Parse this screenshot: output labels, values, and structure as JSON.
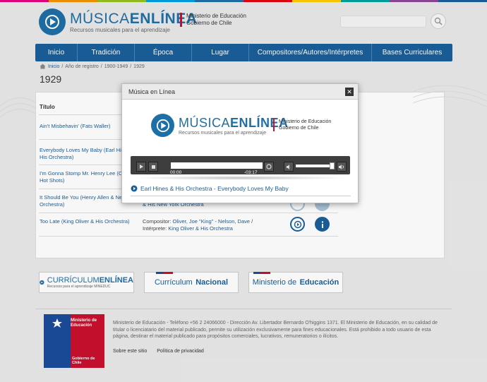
{
  "colors": {
    "brand_blue": "#1e6fa6",
    "nav_blue": "#1a5f9a",
    "gov_red": "#c8102e",
    "top_stripe": [
      "#e6007e",
      "#f39200",
      "#95c11f",
      "#009fe3",
      "#1e6fa6",
      "#e30613",
      "#ffcc00",
      "#00a19a",
      "#8e4796",
      "#1a5f9a"
    ]
  },
  "header": {
    "logo_title_light": "MÚSICA",
    "logo_title_bold": "ENLÍNEA",
    "logo_subtitle": "Recursos musicales para el aprendizaje",
    "gov_line1": "Ministerio de Educación",
    "gov_line2": "Gobierno de Chile",
    "search_placeholder": "",
    "search_icon": "search-icon"
  },
  "nav": {
    "items": [
      {
        "label": "Inicio"
      },
      {
        "label": "Tradición"
      },
      {
        "label": "Época"
      },
      {
        "label": "Lugar"
      },
      {
        "label": "Compositores/Autores/Intérpretes"
      },
      {
        "label": "Bases Curriculares"
      }
    ]
  },
  "breadcrumb": {
    "home": "Inicio",
    "sep1": "/",
    "level2": "Año de registro",
    "sep2": "/",
    "level3": "1900-1949",
    "sep3": "/",
    "level4": "1929"
  },
  "page": {
    "title": "1929",
    "column_title": "Título"
  },
  "rows": [
    {
      "title": "Ain't Misbehavin' (Fats Waller)"
    },
    {
      "title": "Everybody Loves My Baby (Earl Hines & His Orchestra)"
    },
    {
      "title": "I'm Gonna Stomp Mr. Henry Lee (Condon Hot Shots)"
    },
    {
      "title": "It Should Be You (Henry Allen & New York Orchestra)",
      "detail_tail": "& His New York Orchestra"
    },
    {
      "title": "Too Late (King Oliver & His Orchestra)",
      "composer_label": "Compositor:",
      "composer_value": "Oliver, Joe \"King\"  - Nelson, Dave",
      "separator": "/",
      "performer_label": "Intérprete:",
      "performer_value": "King Oliver & His Orchestra"
    }
  ],
  "partners": {
    "curriculum_light": "CURRÍCULUM",
    "curriculum_bold": "ENLÍNEA",
    "curriculum_sub": "Recursos para el aprendizaje MINEDUC",
    "nacional_light": "Currículum",
    "nacional_bold": "Nacional",
    "mineduc_light": "Ministerio de",
    "mineduc_bold": "Educación"
  },
  "footer": {
    "logo_line1": "Ministerio de",
    "logo_line2": "Educación",
    "logo_gob": "Gobierno de Chile",
    "text": "Ministerio de Educación - Teléfono +56 2 24066000 - Dirección Av. Libertador Bernardo O'higgins 1371. El Ministerio de Educación, en su calidad de titular o licenciatario del material publicado, permite su utilización exclusivamente para fines educacionales. Está prohibido a todo usuario de esta página, destinar el material publicado para propósitos comerciales, lucrativos, remuneratorios o ilícitos.",
    "link1": "Sobre este sitio",
    "link2": "Política de privacidad"
  },
  "modal": {
    "title": "Música en Línea",
    "close_label": "✕",
    "time_current": "00:00",
    "time_remaining": "-03:17",
    "progress": 0,
    "volume": 0.85,
    "track": "Earl Hines & His Orchestra - Everybody Loves My Baby"
  }
}
